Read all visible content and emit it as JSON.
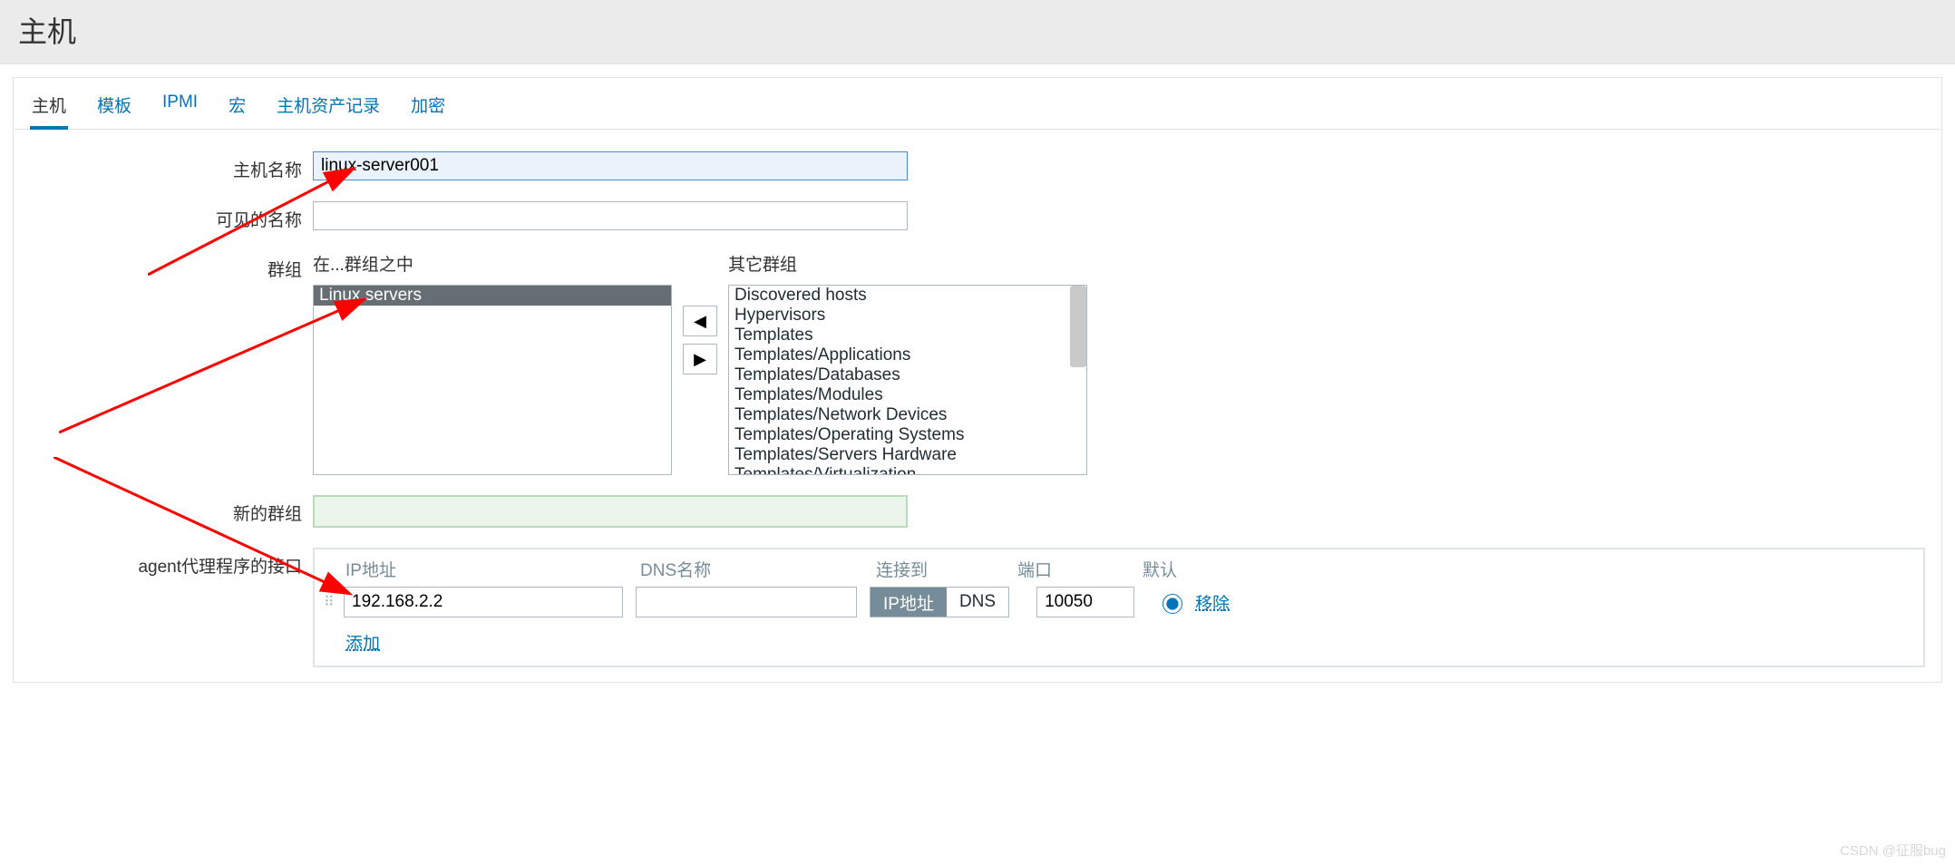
{
  "header": {
    "title": "主机"
  },
  "tabs": [
    {
      "label": "主机",
      "active": true
    },
    {
      "label": "模板"
    },
    {
      "label": "IPMI"
    },
    {
      "label": "宏"
    },
    {
      "label": "主机资产记录"
    },
    {
      "label": "加密"
    }
  ],
  "form": {
    "hostname_label": "主机名称",
    "hostname_value": "linux-server001",
    "visible_name_label": "可见的名称",
    "visible_name_value": "",
    "groups_label": "群组",
    "in_groups_title": "在...群组之中",
    "other_groups_title": "其它群组",
    "in_groups": [
      {
        "label": "Linux servers",
        "selected": true
      }
    ],
    "other_groups": [
      "Discovered hosts",
      "Hypervisors",
      "Templates",
      "Templates/Applications",
      "Templates/Databases",
      "Templates/Modules",
      "Templates/Network Devices",
      "Templates/Operating Systems",
      "Templates/Servers Hardware",
      "Templates/Virtualization"
    ],
    "move_left_icon": "◀",
    "move_right_icon": "▶",
    "new_group_label": "新的群组",
    "new_group_value": ""
  },
  "interfaces": {
    "section_label": "agent代理程序的接口",
    "col_ip": "IP地址",
    "col_dns": "DNS名称",
    "col_connect": "连接到",
    "col_port": "端口",
    "col_default": "默认",
    "row": {
      "ip": "192.168.2.2",
      "dns": "",
      "connect_ip_label": "IP地址",
      "connect_dns_label": "DNS",
      "connect_active": "ip",
      "port": "10050",
      "remove_label": "移除"
    },
    "add_label": "添加"
  },
  "watermark": "CSDN @征服bug"
}
